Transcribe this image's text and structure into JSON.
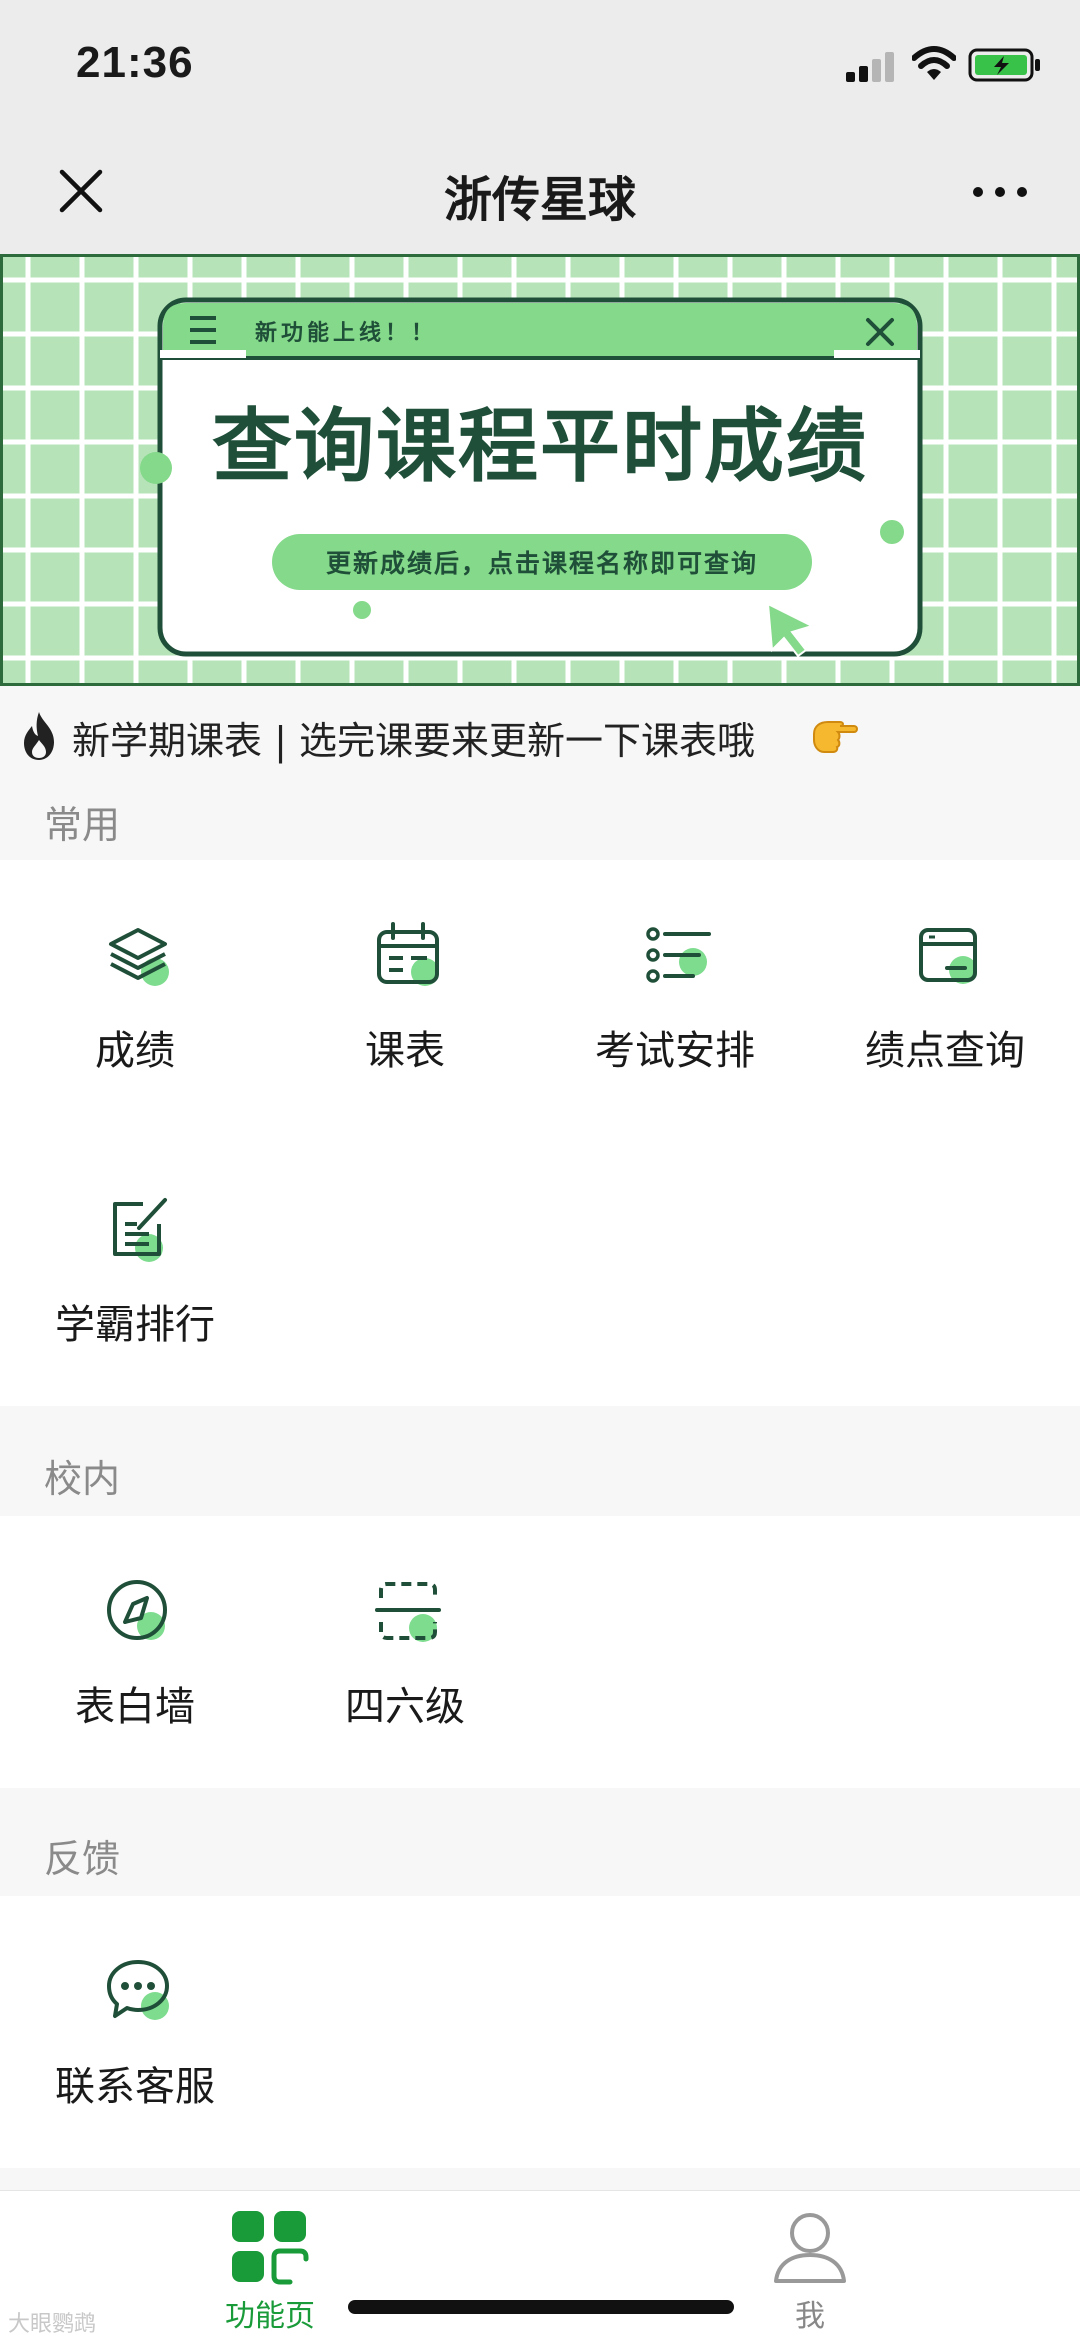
{
  "status_bar": {
    "time": "21:36"
  },
  "nav": {
    "title": "浙传星球"
  },
  "banner": {
    "header": "新功能上线！！",
    "headline": "查询课程平时成绩",
    "sub": "更新成绩后，点击课程名称即可查询"
  },
  "notice": {
    "text": "新学期课表 | 选完课要来更新一下课表哦"
  },
  "sections": {
    "common": {
      "title": "常用",
      "items": [
        {
          "label": "成绩",
          "icon": "layers-icon"
        },
        {
          "label": "课表",
          "icon": "calendar-icon"
        },
        {
          "label": "考试安排",
          "icon": "list-icon"
        },
        {
          "label": "绩点查询",
          "icon": "card-icon"
        },
        {
          "label": "学霸排行",
          "icon": "edit-icon"
        }
      ]
    },
    "campus": {
      "title": "校内",
      "items": [
        {
          "label": "表白墙",
          "icon": "compass-icon"
        },
        {
          "label": "四六级",
          "icon": "scan-icon"
        }
      ]
    },
    "feedback": {
      "title": "反馈",
      "items": [
        {
          "label": "联系客服",
          "icon": "chat-icon"
        }
      ]
    }
  },
  "tabs": [
    {
      "label": "功能页",
      "active": true
    },
    {
      "label": "我",
      "active": false
    }
  ],
  "watermark": "大眼鹦鹉",
  "colors": {
    "accent": "#1a9b3a",
    "accent_light": "#7edc8f",
    "icon_dark": "#1f4f38",
    "banner_bg": "#b6e4b8"
  }
}
